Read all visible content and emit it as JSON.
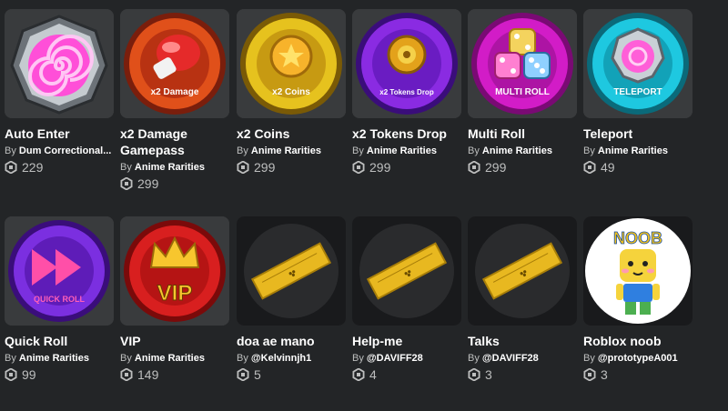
{
  "passes": [
    {
      "name": "Auto Enter",
      "by": "By",
      "creator": "Dum Correctional...",
      "price": "229",
      "art": "portal",
      "label": ""
    },
    {
      "name": "x2 Damage Gamepass",
      "by": "By",
      "creator": "Anime Rarities",
      "price": "299",
      "art": "glove",
      "label": "x2 Damage"
    },
    {
      "name": "x2 Coins",
      "by": "By",
      "creator": "Anime Rarities",
      "price": "299",
      "art": "coin",
      "label": "x2 Coins"
    },
    {
      "name": "x2 Tokens Drop",
      "by": "By",
      "creator": "Anime Rarities",
      "price": "299",
      "art": "token",
      "label": "x2 Tokens Drop"
    },
    {
      "name": "Multi Roll",
      "by": "By",
      "creator": "Anime Rarities",
      "price": "299",
      "art": "dice",
      "label": "MULTI ROLL"
    },
    {
      "name": "Teleport",
      "by": "By",
      "creator": "Anime Rarities",
      "price": "49",
      "art": "teleport",
      "label": "TELEPORT"
    },
    {
      "name": "Quick Roll",
      "by": "By",
      "creator": "Anime Rarities",
      "price": "99",
      "art": "quickroll",
      "label": "QUICK ROLL"
    },
    {
      "name": "VIP",
      "by": "By",
      "creator": "Anime Rarities",
      "price": "149",
      "art": "vip",
      "label": "VIP"
    },
    {
      "name": "doa ae mano",
      "by": "By",
      "creator": "@Kelvinnjh1",
      "price": "5",
      "art": "ticket",
      "label": ""
    },
    {
      "name": "Help-me",
      "by": "By",
      "creator": "@DAVIFF28",
      "price": "4",
      "art": "ticket",
      "label": ""
    },
    {
      "name": "Talks",
      "by": "By",
      "creator": "@DAVIFF28",
      "price": "3",
      "art": "ticket",
      "label": ""
    },
    {
      "name": "Roblox noob",
      "by": "By",
      "creator": "@prototypeA001",
      "price": "3",
      "art": "noob",
      "label": "NOOB"
    }
  ],
  "icons": {
    "currency": "robux-icon"
  }
}
